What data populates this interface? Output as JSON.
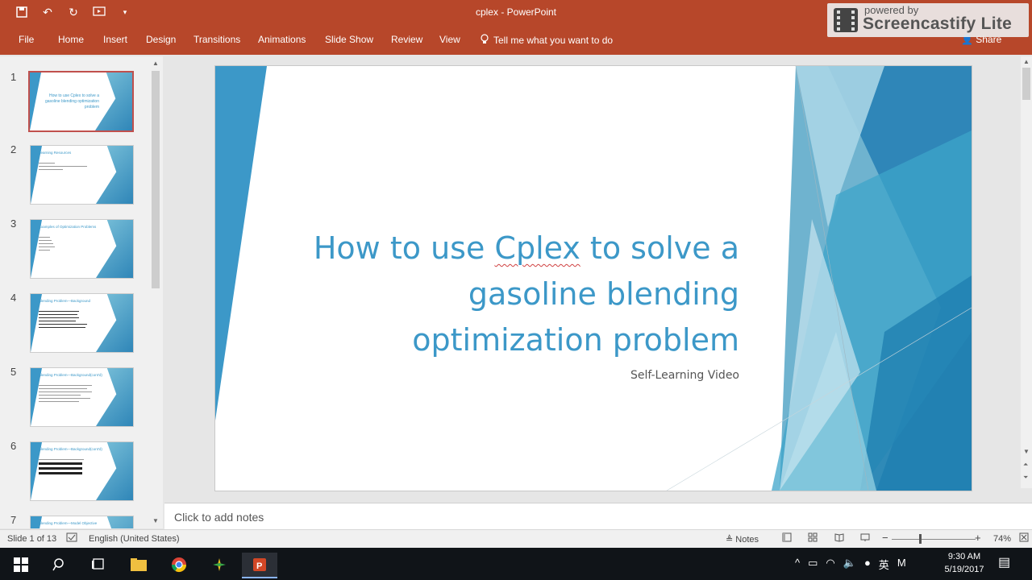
{
  "titlebar": {
    "doc_title": "cplex  -  PowerPoint",
    "color": "#b7472a"
  },
  "ribbon": {
    "tabs": [
      "File",
      "Home",
      "Insert",
      "Design",
      "Transitions",
      "Animations",
      "Slide Show",
      "Review",
      "View"
    ],
    "tell_me": "Tell me what you want to do",
    "share": "Share"
  },
  "watermark": {
    "top": "powered by",
    "main": "Screencastify Lite"
  },
  "thumbnails": [
    {
      "num": "1",
      "title": "How to use Cplex to solve a gasoline blending optimization problem"
    },
    {
      "num": "2",
      "title": "Learning Resources"
    },
    {
      "num": "3",
      "title": "Examples of Optimization Problems"
    },
    {
      "num": "4",
      "title": "Blending Problem—Background"
    },
    {
      "num": "5",
      "title": "Blending Problem—Background(cont'd)"
    },
    {
      "num": "6",
      "title": "Blending Problem—Background(cont'd)"
    },
    {
      "num": "7",
      "title": "Blending Problem—Model Objective"
    }
  ],
  "slide": {
    "title_line1_a": "How to use ",
    "title_line1_word": "Cplex",
    "title_line1_b": " to solve a",
    "title_line2": "gasoline blending",
    "title_line3": "optimization problem",
    "subtitle": "Self-Learning Video",
    "accent": "#3c98c8"
  },
  "notes": {
    "placeholder": "Click to add notes"
  },
  "status": {
    "slide_info": "Slide 1 of 13",
    "language": "English (United States)",
    "notes_label": "Notes",
    "zoom": "74%"
  },
  "taskbar": {
    "time": "9:30 AM",
    "date": "5/19/2017",
    "ime": "英"
  }
}
